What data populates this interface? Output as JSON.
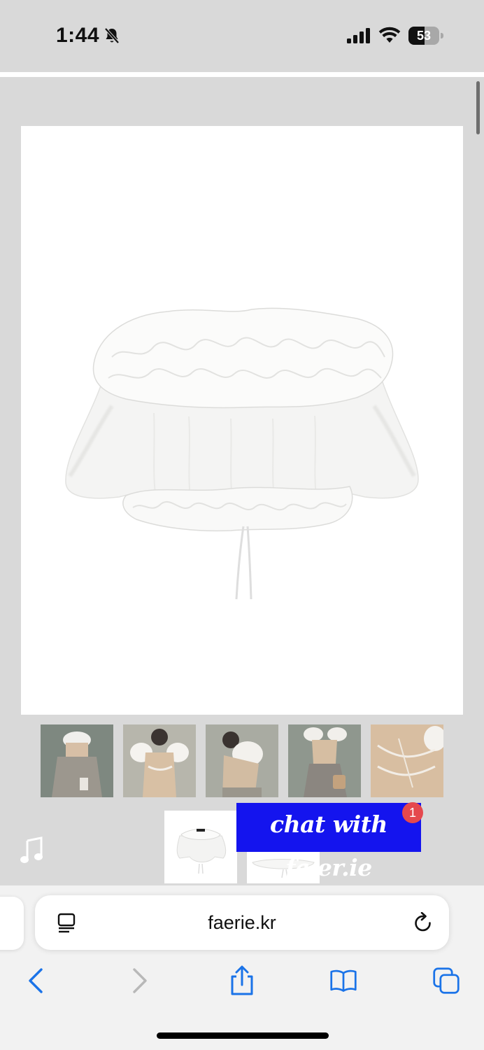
{
  "status_bar": {
    "time": "1:44",
    "battery_level": "53",
    "battery_fraction": 0.53,
    "icons": [
      "bell-slash-icon",
      "cellular-signal-icon",
      "wifi-icon",
      "battery-icon"
    ]
  },
  "page": {
    "main_image_alt": "white ruffle off-shoulder puff-sleeve crop top with drawstring",
    "thumbnails": [
      {
        "label": "model front with grey skirt"
      },
      {
        "label": "model wearing sheer top, front"
      },
      {
        "label": "model side view"
      },
      {
        "label": "model holding bag"
      },
      {
        "label": "back detail close-up"
      },
      {
        "label": "product flat front"
      },
      {
        "label": "product flat detail"
      }
    ],
    "music_icon": "music-note-icon",
    "chat_banner": {
      "text": "chat with fa.er.ie",
      "badge_count": "1",
      "bg_color": "#1414ee"
    }
  },
  "browser": {
    "url": "faerie.kr",
    "toolbar": [
      "back-icon",
      "forward-icon",
      "share-icon",
      "bookmarks-icon",
      "tabs-icon"
    ],
    "accent_color": "#1a73e8"
  }
}
